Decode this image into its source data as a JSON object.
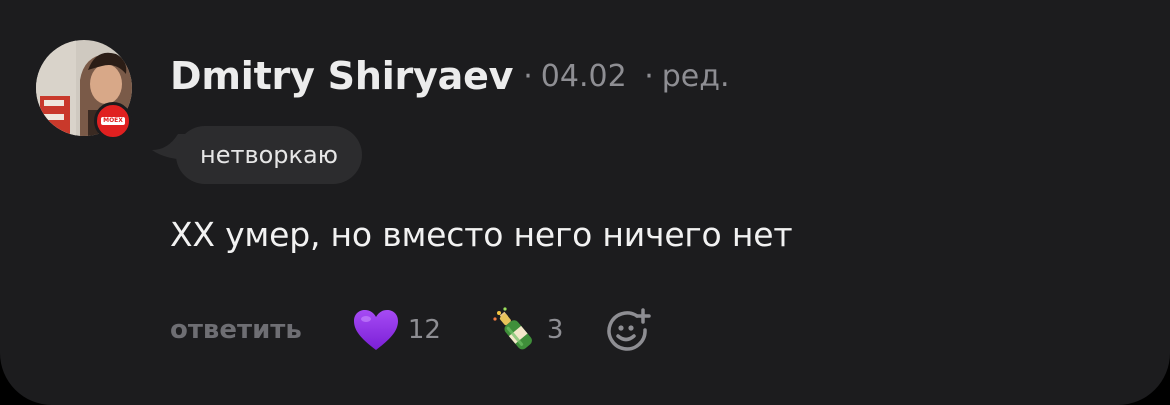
{
  "comment": {
    "author": "Dmitry Shiryaev",
    "separator": "·",
    "date": "04.02",
    "edited_label": "ред.",
    "avatar_badge": "MOEX",
    "tag": "нетворкаю",
    "text": "XX умер, но вместо него ничего нет",
    "reply_label": "ответить",
    "reactions": [
      {
        "emoji": "purple-heart",
        "count": "12"
      },
      {
        "emoji": "champagne-bottle",
        "count": "3"
      }
    ],
    "add_reaction_icon": "smiley-plus-icon"
  },
  "colors": {
    "card_background": "#1c1c1e",
    "bubble_background": "#2c2c2e",
    "author_text": "#ececec",
    "muted_text": "#8e8e93",
    "reply_text": "#6e6e73",
    "badge_red": "#e02020",
    "heart_purple": "#8a2be2"
  }
}
